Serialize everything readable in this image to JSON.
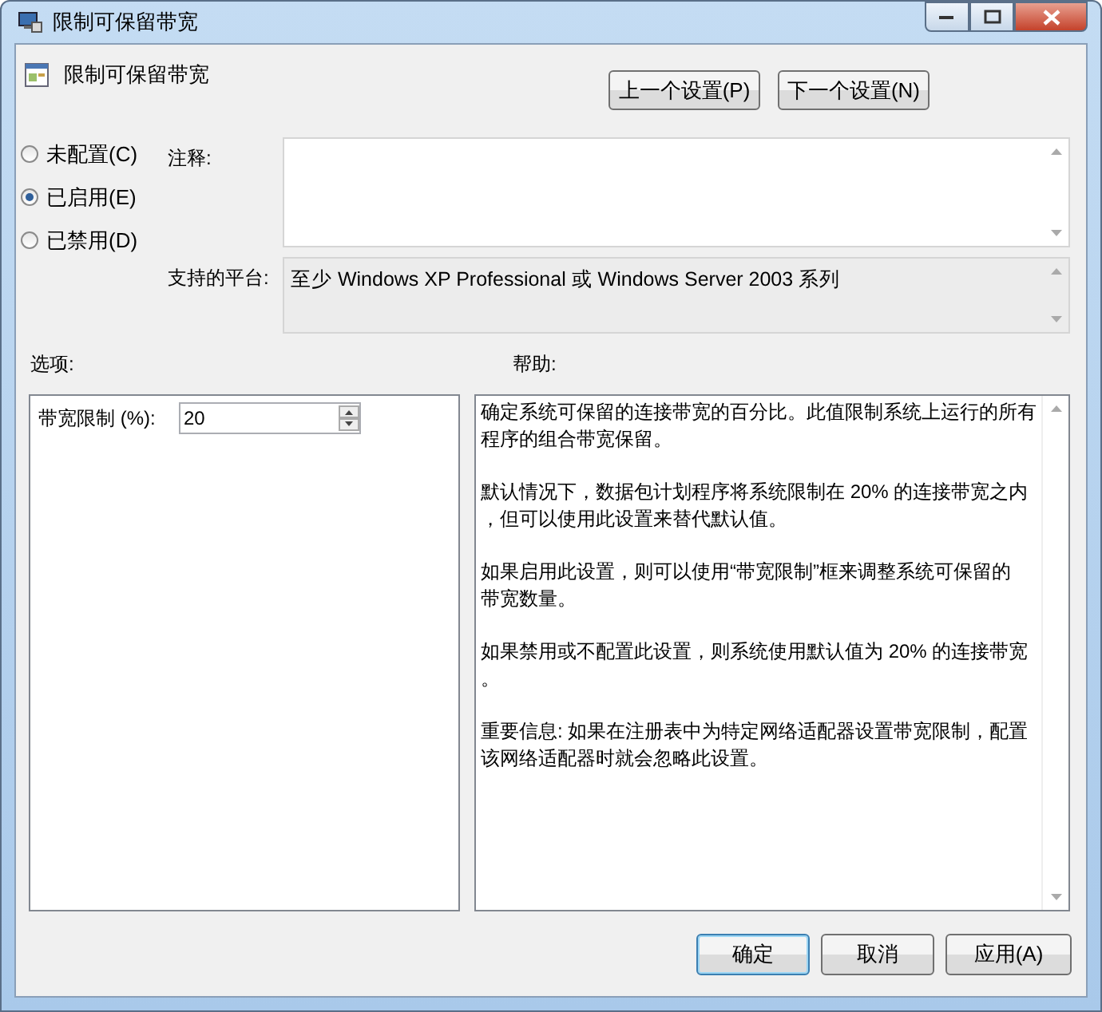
{
  "window": {
    "title": "限制可保留带宽"
  },
  "policy_name": "限制可保留带宽",
  "nav_buttons": [
    "上一个设置(P)",
    "下一个设置(N)"
  ],
  "states": [
    {
      "label": "未配置(C)",
      "selected": false
    },
    {
      "label": "已启用(E)",
      "selected": true
    },
    {
      "label": "已禁用(D)",
      "selected": false
    }
  ],
  "comment": {
    "label": "注释:"
  },
  "platform": {
    "label": "支持的平台:",
    "value": "至少 Windows XP Professional 或 Windows Server 2003 系列"
  },
  "options": {
    "label": "选项:",
    "fields": [
      {
        "label": "带宽限制 (%):",
        "value": "20"
      }
    ]
  },
  "help": {
    "label": "帮助:",
    "paragraphs": [
      [
        "确定系统可保留的连接带宽的百分比。此值限制系统上运行的所有",
        "程序的组合带宽保留。"
      ],
      [
        "默认情况下，数据包计划程序将系统限制在 20% 的连接带宽之内",
        "，但可以使用此设置来替代默认值。"
      ],
      [
        "如果启用此设置，则可以使用“带宽限制”框来调整系统可保留的",
        "带宽数量。"
      ],
      [
        "如果禁用或不配置此设置，则系统使用默认值为 20% 的连接带宽",
        "。"
      ],
      [
        "重要信息: 如果在注册表中为特定网络适配器设置带宽限制，配置",
        "该网络适配器时就会忽略此设置。"
      ]
    ]
  },
  "buttons": [
    {
      "label": "确定",
      "kind": "default"
    },
    {
      "label": "取消",
      "kind": "normal"
    },
    {
      "label": "应用(A)",
      "kind": "normal"
    }
  ]
}
